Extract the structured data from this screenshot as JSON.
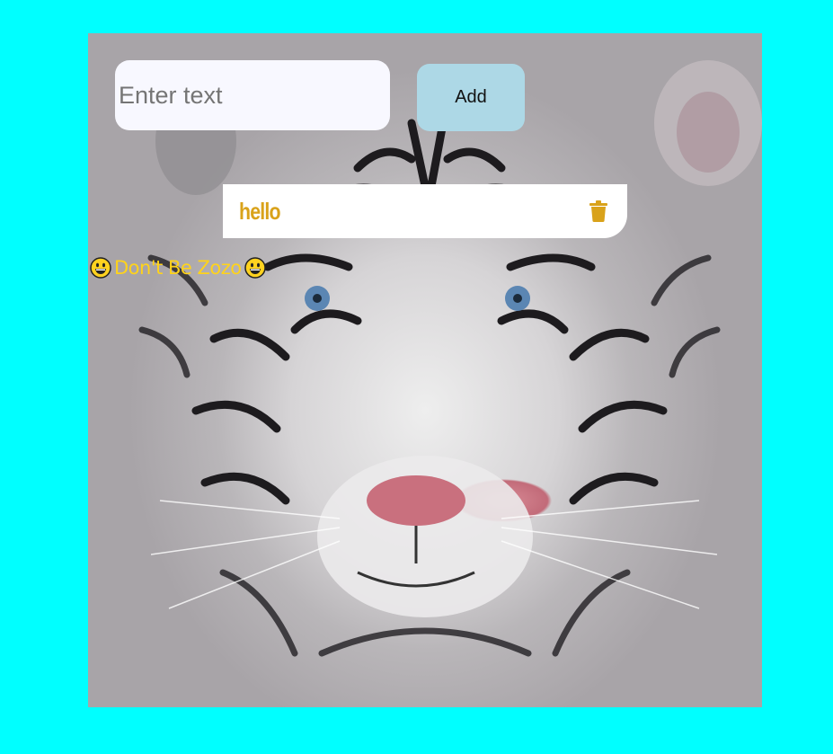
{
  "input": {
    "placeholder": "Enter text",
    "value": ""
  },
  "add_button": {
    "label": "Add"
  },
  "todos": [
    {
      "text": "hello",
      "icon": "trash-icon"
    }
  ],
  "tagline": {
    "text": "Don't Be Zozo",
    "emoji": "grinning-face-icon"
  },
  "colors": {
    "page_background": "#00ffff",
    "input_background": "#f8f8ff",
    "button_background": "#add8e6",
    "todo_text": "#d9a21a",
    "tagline_text": "#ffd31a"
  }
}
